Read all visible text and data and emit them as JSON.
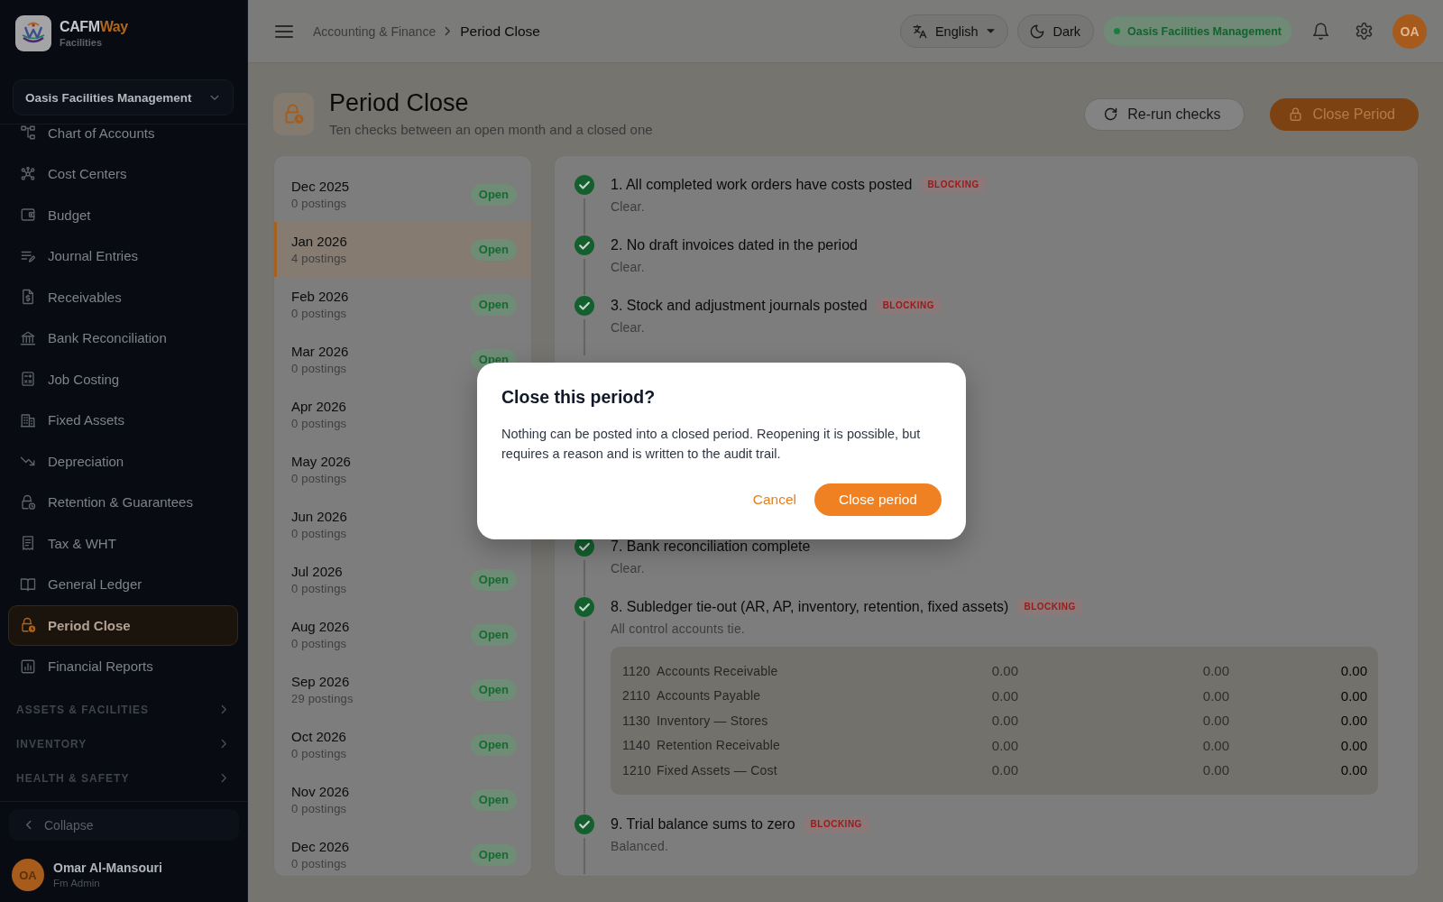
{
  "sidebar": {
    "brand": {
      "name": "CAFM",
      "name_accent": "Way",
      "tagline": "Facilities"
    },
    "org_selector": "Oasis Facilities Management",
    "items": [
      {
        "label": "Chart of Accounts",
        "selected": false
      },
      {
        "label": "Cost Centers",
        "selected": false
      },
      {
        "label": "Budget",
        "selected": false
      },
      {
        "label": "Journal Entries",
        "selected": false
      },
      {
        "label": "Receivables",
        "selected": false
      },
      {
        "label": "Bank Reconciliation",
        "selected": false
      },
      {
        "label": "Job Costing",
        "selected": false
      },
      {
        "label": "Fixed Assets",
        "selected": false
      },
      {
        "label": "Depreciation",
        "selected": false
      },
      {
        "label": "Retention & Guarantees",
        "selected": false
      },
      {
        "label": "Tax & WHT",
        "selected": false
      },
      {
        "label": "General Ledger",
        "selected": false
      },
      {
        "label": "Period Close",
        "selected": true
      },
      {
        "label": "Financial Reports",
        "selected": false
      }
    ],
    "sections": [
      {
        "label": "ASSETS & FACILITIES",
        "expanded": false
      },
      {
        "label": "INVENTORY",
        "expanded": false
      },
      {
        "label": "HEALTH & SAFETY",
        "expanded": false
      }
    ],
    "collapse": "Collapse",
    "user": {
      "initials": "OA",
      "name": "Omar Al-Mansouri",
      "role": "Fm Admin"
    }
  },
  "topbar": {
    "breadcrumb": [
      {
        "label": "Accounting & Finance",
        "current": false
      },
      {
        "label": "Period Close",
        "current": true
      }
    ],
    "language": "English",
    "theme": "Dark",
    "organization": "Oasis Facilities Management",
    "avatar": "OA"
  },
  "page": {
    "title": "Period Close",
    "subtitle": "Ten checks between an open month and a closed one",
    "actions": [
      {
        "label": "Re-run checks",
        "kind": "secondary"
      },
      {
        "label": "Close Period",
        "kind": "primary"
      }
    ]
  },
  "periods": [
    {
      "month": "Dec 2025",
      "postings": "0 postings",
      "status": "Open",
      "selected": false
    },
    {
      "month": "Jan 2026",
      "postings": "4 postings",
      "status": "Open",
      "selected": true
    },
    {
      "month": "Feb 2026",
      "postings": "0 postings",
      "status": "Open",
      "selected": false
    },
    {
      "month": "Mar 2026",
      "postings": "0 postings",
      "status": "Open",
      "selected": false
    },
    {
      "month": "Apr 2026",
      "postings": "0 postings",
      "selected": false
    },
    {
      "month": "May 2026",
      "postings": "0 postings",
      "selected": false
    },
    {
      "month": "Jun 2026",
      "postings": "0 postings",
      "selected": false
    },
    {
      "month": "Jul 2026",
      "postings": "0 postings",
      "status": "Open",
      "selected": false
    },
    {
      "month": "Aug 2026",
      "postings": "0 postings",
      "status": "Open",
      "selected": false
    },
    {
      "month": "Sep 2026",
      "postings": "29 postings",
      "status": "Open",
      "selected": false
    },
    {
      "month": "Oct 2026",
      "postings": "0 postings",
      "status": "Open",
      "selected": false
    },
    {
      "month": "Nov 2026",
      "postings": "0 postings",
      "status": "Open",
      "selected": false
    },
    {
      "month": "Dec 2026",
      "postings": "0 postings",
      "status": "Open",
      "selected": false
    }
  ],
  "check_groups": [
    {
      "items": [
        {
          "title": "1. All completed work orders have costs posted",
          "badge": "BLOCKING",
          "detail": "Clear.",
          "passed": true
        },
        {
          "title": "2. No draft invoices dated in the period",
          "detail": "Clear.",
          "passed": true
        },
        {
          "title": "3. Stock and adjustment journals posted",
          "badge": "BLOCKING",
          "detail": "Clear.",
          "passed": true
        }
      ]
    },
    {
      "items": [
        {
          "title": "7. Bank reconciliation complete",
          "detail": "Clear.",
          "passed": true
        },
        {
          "title": "8. Subledger tie-out (AR, AP, inventory, retention, fixed assets)",
          "badge": "BLOCKING",
          "detail": "All control accounts tie.",
          "passed": true,
          "accounts": [
            {
              "code": "1120",
              "name": "Accounts Receivable",
              "amounts": [
                "0.00",
                "0.00",
                "0.00"
              ]
            },
            {
              "code": "2110",
              "name": "Accounts Payable",
              "amounts": [
                "0.00",
                "0.00",
                "0.00"
              ]
            },
            {
              "code": "1130",
              "name": "Inventory — Stores",
              "amounts": [
                "0.00",
                "0.00",
                "0.00"
              ]
            },
            {
              "code": "1140",
              "name": "Retention Receivable",
              "amounts": [
                "0.00",
                "0.00",
                "0.00"
              ]
            },
            {
              "code": "1210",
              "name": "Fixed Assets — Cost",
              "amounts": [
                "0.00",
                "0.00",
                "0.00"
              ]
            }
          ]
        },
        {
          "title": "9. Trial balance sums to zero",
          "badge": "BLOCKING",
          "detail": "Balanced.",
          "passed": true
        }
      ]
    }
  ],
  "dialog": {
    "title": "Close this period?",
    "message": "Nothing can be posted into a closed period. Reopening it is possible, but requires a reason and is written to the audit trail.",
    "buttons": [
      {
        "label": "Cancel",
        "kind": "text"
      },
      {
        "label": "Close period",
        "kind": "primary"
      }
    ]
  }
}
